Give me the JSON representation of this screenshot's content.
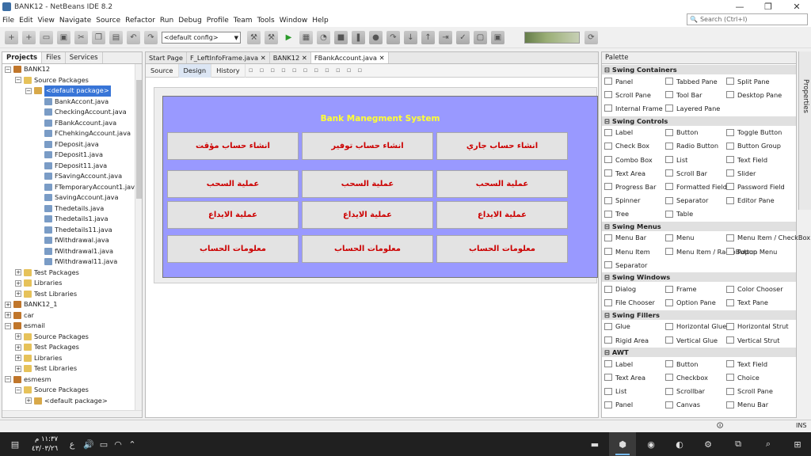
{
  "window": {
    "title": "BANK12 - NetBeans IDE 8.2",
    "minimize": "—",
    "maximize": "❐",
    "close": "✕"
  },
  "menu": [
    "File",
    "Edit",
    "View",
    "Navigate",
    "Source",
    "Refactor",
    "Run",
    "Debug",
    "Profile",
    "Team",
    "Tools",
    "Window",
    "Help"
  ],
  "search": {
    "placeholder": "Search (Ctrl+I)"
  },
  "toolbar": {
    "config": "<default config>"
  },
  "projects": {
    "tabs": [
      "Projects",
      "Files",
      "Services"
    ],
    "tree": [
      {
        "label": "BANK12",
        "level": 0,
        "icon": "project-icon"
      },
      {
        "label": "Source Packages",
        "level": 1,
        "icon": "folder-icon"
      },
      {
        "label": "<default package>",
        "level": 2,
        "icon": "package-icon",
        "selected": true
      },
      {
        "label": "BankAccont.java",
        "level": 3,
        "icon": "java-file-icon"
      },
      {
        "label": "CheckingAccount.java",
        "level": 3,
        "icon": "java-file-icon"
      },
      {
        "label": "FBankAccount.java",
        "level": 3,
        "icon": "java-file-icon"
      },
      {
        "label": "FChehkingAccount.java",
        "level": 3,
        "icon": "java-file-icon"
      },
      {
        "label": "FDeposit.java",
        "level": 3,
        "icon": "java-file-icon"
      },
      {
        "label": "FDeposit1.java",
        "level": 3,
        "icon": "java-file-icon"
      },
      {
        "label": "FDeposit11.java",
        "level": 3,
        "icon": "java-file-icon"
      },
      {
        "label": "FSavingAccount.java",
        "level": 3,
        "icon": "java-file-icon"
      },
      {
        "label": "FTemporaryAccount1.java",
        "level": 3,
        "icon": "java-file-icon"
      },
      {
        "label": "SavingAccount.java",
        "level": 3,
        "icon": "java-file-icon"
      },
      {
        "label": "Thedetails.java",
        "level": 3,
        "icon": "java-file-icon"
      },
      {
        "label": "Thedetails1.java",
        "level": 3,
        "icon": "java-file-icon"
      },
      {
        "label": "Thedetails11.java",
        "level": 3,
        "icon": "java-file-icon"
      },
      {
        "label": "fWithdrawal.java",
        "level": 3,
        "icon": "java-file-icon"
      },
      {
        "label": "fWithdrawal1.java",
        "level": 3,
        "icon": "java-file-icon"
      },
      {
        "label": "fWithdrawal11.java",
        "level": 3,
        "icon": "java-file-icon"
      },
      {
        "label": "Test Packages",
        "level": 1,
        "icon": "folder-icon"
      },
      {
        "label": "Libraries",
        "level": 1,
        "icon": "folder-icon"
      },
      {
        "label": "Test Libraries",
        "level": 1,
        "icon": "folder-icon"
      },
      {
        "label": "BANK12_1",
        "level": 0,
        "icon": "project-icon"
      },
      {
        "label": "car",
        "level": 0,
        "icon": "project-icon"
      },
      {
        "label": "esmail",
        "level": 0,
        "icon": "project-icon"
      },
      {
        "label": "Source Packages",
        "level": 1,
        "icon": "folder-icon"
      },
      {
        "label": "Test Packages",
        "level": 1,
        "icon": "folder-icon"
      },
      {
        "label": "Libraries",
        "level": 1,
        "icon": "folder-icon"
      },
      {
        "label": "Test Libraries",
        "level": 1,
        "icon": "folder-icon"
      },
      {
        "label": "esmesm",
        "level": 0,
        "icon": "project-icon"
      },
      {
        "label": "Source Packages",
        "level": 1,
        "icon": "folder-icon"
      },
      {
        "label": "<default package>",
        "level": 2,
        "icon": "package-icon"
      }
    ]
  },
  "editor": {
    "tabs": [
      "Start Page",
      "F_LeftInfoFrame.java",
      "BANK12",
      "FBankAccount.java"
    ],
    "views": [
      "Source",
      "Design",
      "History"
    ],
    "form_title": "Bank Manegment System",
    "buttons": [
      [
        "انشاء حساب مؤقت",
        "انشاء حساب توفير",
        "انشاء حساب جاري"
      ],
      [
        "عملية السحب",
        "عملية السحب",
        "عملية السحب"
      ],
      [
        "عملية الايداع",
        "عملية الايداع",
        "عملية الايداع"
      ],
      [
        "معلومات الحساب",
        "معلومات الحساب",
        "معلومات الحساب"
      ]
    ]
  },
  "palette": {
    "title": "Palette",
    "side_tab": "Properties",
    "categories": [
      {
        "name": "Swing Containers",
        "items": [
          "Panel",
          "Tabbed Pane",
          "Split Pane",
          "Scroll Pane",
          "Tool Bar",
          "Desktop Pane",
          "Internal Frame",
          "Layered Pane"
        ]
      },
      {
        "name": "Swing Controls",
        "items": [
          "Label",
          "Button",
          "Toggle Button",
          "Check Box",
          "Radio Button",
          "Button Group",
          "Combo Box",
          "List",
          "Text Field",
          "Text Area",
          "Scroll Bar",
          "Slider",
          "Progress Bar",
          "Formatted Field",
          "Password Field",
          "Spinner",
          "Separator",
          "Editor Pane",
          "Tree",
          "Table"
        ]
      },
      {
        "name": "Swing Menus",
        "items": [
          "Menu Bar",
          "Menu",
          "Menu Item / CheckBox",
          "Menu Item",
          "Menu Item / RadioButton",
          "Popup Menu",
          "Separator"
        ]
      },
      {
        "name": "Swing Windows",
        "items": [
          "Dialog",
          "Frame",
          "Color Chooser",
          "File Chooser",
          "Option Pane",
          "Text Pane"
        ]
      },
      {
        "name": "Swing Fillers",
        "items": [
          "Glue",
          "Horizontal Glue",
          "Horizontal Strut",
          "Rigid Area",
          "Vertical Glue",
          "Vertical Strut"
        ]
      },
      {
        "name": "AWT",
        "items": [
          "Label",
          "Button",
          "Text Field",
          "Text Area",
          "Checkbox",
          "Choice",
          "List",
          "Scrollbar",
          "Scroll Pane",
          "Panel",
          "Canvas",
          "Menu Bar"
        ]
      }
    ]
  },
  "status": {
    "mode": "INS"
  },
  "taskbar": {
    "time": "١١:٣٧ م",
    "date": "٤٣/٠٣/٢٦",
    "lang": "ع"
  }
}
